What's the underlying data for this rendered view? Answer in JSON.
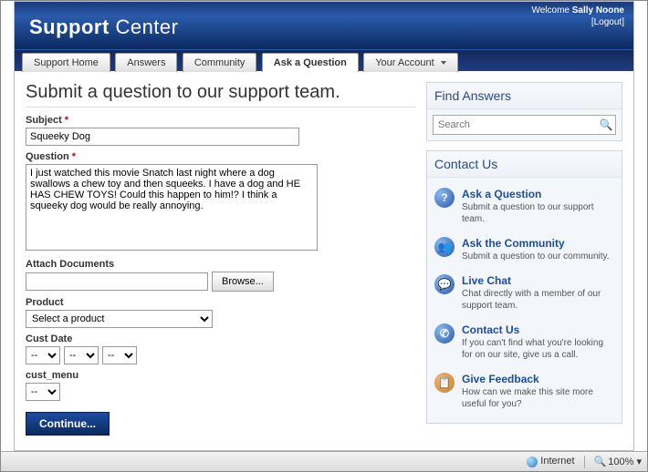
{
  "header": {
    "title_bold": "Support",
    "title_light": "Center",
    "welcome_prefix": "Welcome",
    "user_name": "Sally Noone",
    "logout": "[Logout]"
  },
  "nav": {
    "tabs": [
      {
        "label": "Support Home",
        "active": false,
        "dropdown": false
      },
      {
        "label": "Answers",
        "active": false,
        "dropdown": false
      },
      {
        "label": "Community",
        "active": false,
        "dropdown": false
      },
      {
        "label": "Ask a Question",
        "active": true,
        "dropdown": false
      },
      {
        "label": "Your Account",
        "active": false,
        "dropdown": true
      }
    ]
  },
  "main": {
    "page_title": "Submit a question to our support team.",
    "subject_label": "Subject",
    "subject_value": "Squeeky Dog",
    "question_label": "Question",
    "question_value": "I just watched this movie Snatch last night where a dog swallows a chew toy and then squeeks. I have a dog and HE HAS CHEW TOYS! Could this happen to him!? I think a squeeky dog would be really annoying.",
    "attach_label": "Attach Documents",
    "attach_value": "",
    "browse_label": "Browse...",
    "product_label": "Product",
    "product_value": "Select a product",
    "custdate_label": "Cust Date",
    "date_part": "--",
    "custmenu_label": "cust_menu",
    "custmenu_value": "--",
    "continue_label": "Continue..."
  },
  "sidebar": {
    "find_title": "Find Answers",
    "search_placeholder": "Search",
    "contact_title": "Contact Us",
    "items": [
      {
        "icon": "?",
        "title": "Ask a Question",
        "desc": "Submit a question to our support team."
      },
      {
        "icon": "👥",
        "title": "Ask the Community",
        "desc": "Submit a question to our community."
      },
      {
        "icon": "💬",
        "title": "Live Chat",
        "desc": "Chat directly with a member of our support team."
      },
      {
        "icon": "✆",
        "title": "Contact Us",
        "desc": "If you can't find what you're looking for on our site, give us a call."
      },
      {
        "icon": "📋",
        "title": "Give Feedback",
        "desc": "How can we make this site more useful for you?"
      }
    ]
  },
  "statusbar": {
    "zone": "Internet",
    "zoom": "100%"
  }
}
